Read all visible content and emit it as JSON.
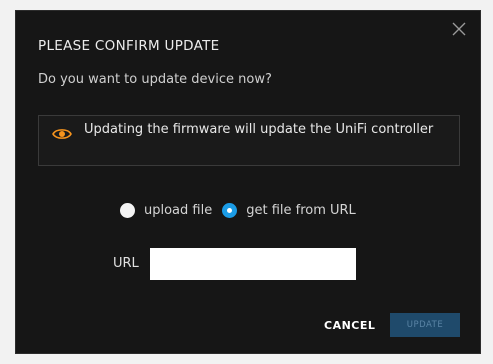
{
  "dialog": {
    "title": "PLEASE CONFIRM UPDATE",
    "question": "Do you want to update device now?",
    "close_icon": "close-icon",
    "warning": {
      "icon": "eye-icon",
      "icon_color": "#f7941d",
      "text": "Updating the firmware will update the UniFi controller"
    },
    "source_options": [
      {
        "label": "upload file",
        "selected": false
      },
      {
        "label": "get file from URL",
        "selected": true
      }
    ],
    "url": {
      "label": "URL",
      "value": "",
      "placeholder": ""
    },
    "buttons": {
      "cancel": "CANCEL",
      "update": "UPDATE",
      "update_enabled": false
    },
    "colors": {
      "background": "#161616",
      "accent": "#1b9ce6",
      "update_disabled_bg": "#1f4a6b"
    }
  }
}
